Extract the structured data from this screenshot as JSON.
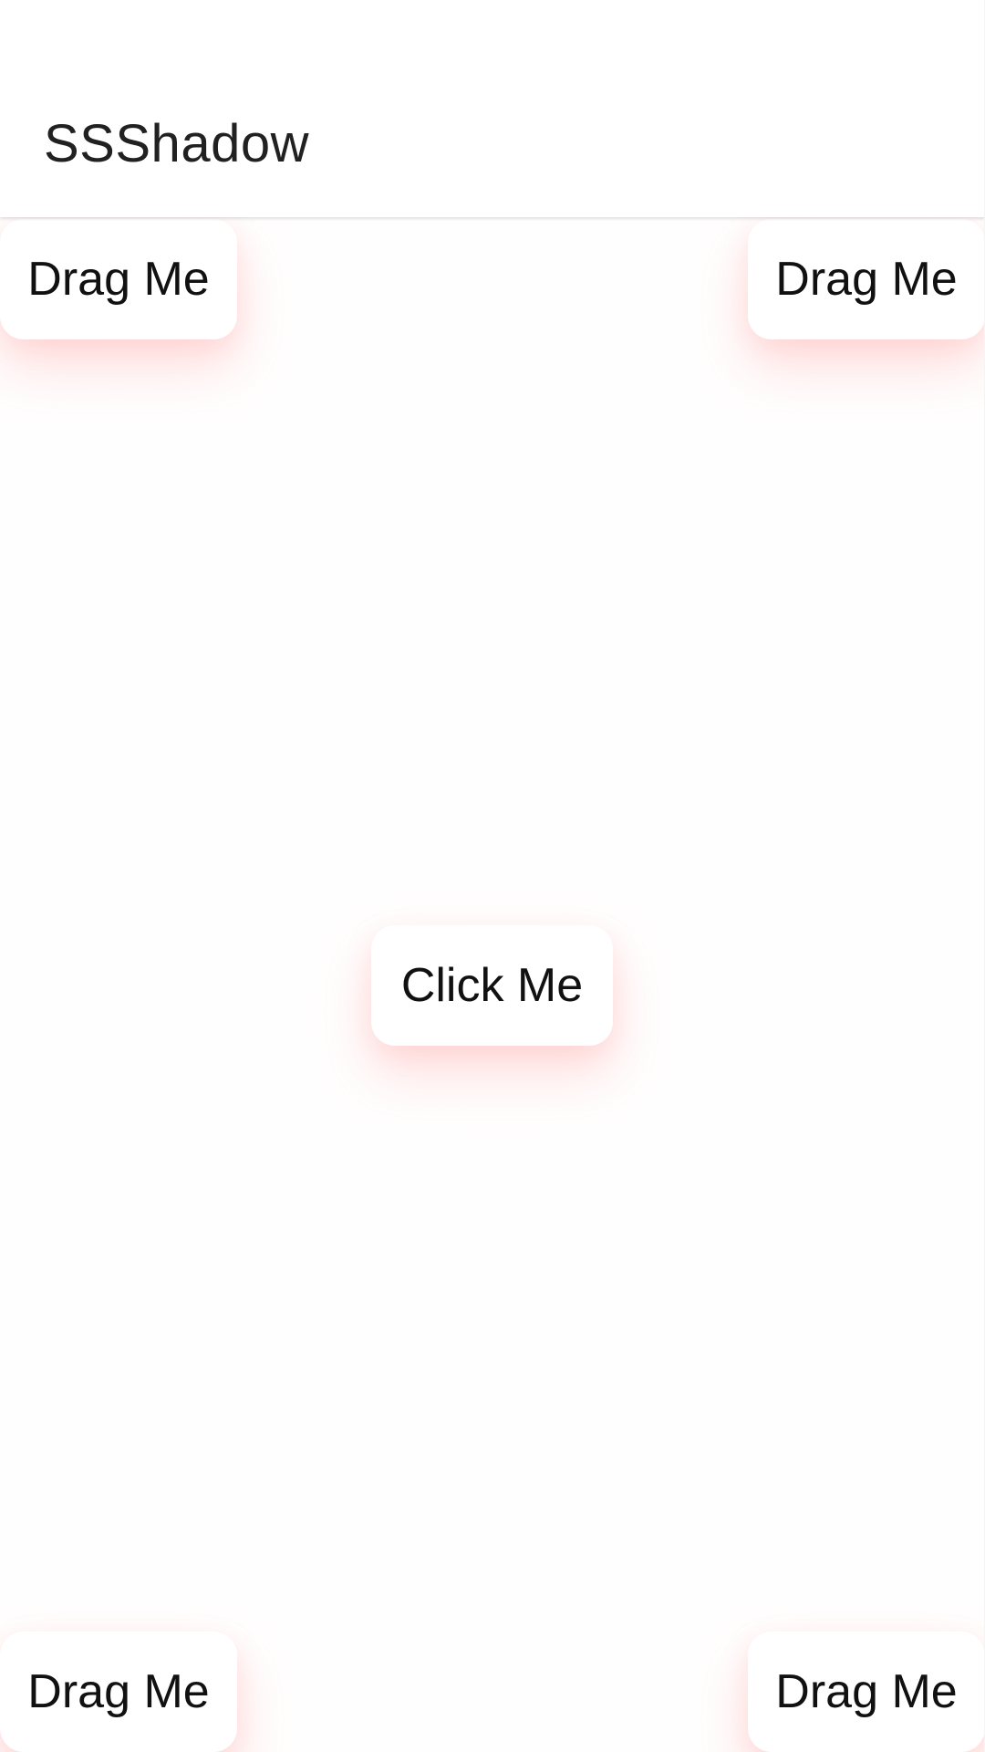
{
  "app": {
    "title": "SSShadow"
  },
  "buttons": {
    "drag_top_left": "Drag Me",
    "drag_top_right": "Drag Me",
    "click_center": "Click Me",
    "drag_bottom_left": "Drag Me",
    "drag_bottom_right": "Drag Me"
  },
  "colors": {
    "background": "#ffffff",
    "title_text": "#212121",
    "button_text": "#111111",
    "shadow_tint": "#ff9696"
  }
}
